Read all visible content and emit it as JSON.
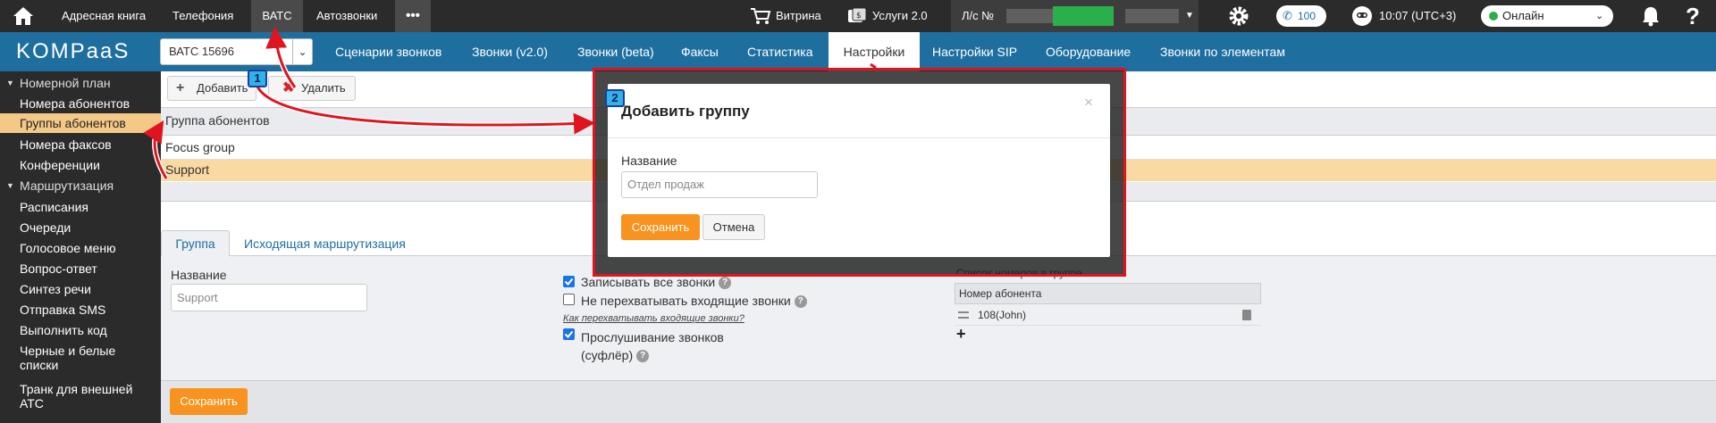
{
  "topbar": {
    "nav": [
      "Адресная книга",
      "Телефония",
      "ВАТС",
      "Автозвонки"
    ],
    "more": "•••",
    "showcase": "Витрина",
    "services": "Услуги 2.0",
    "account_label": "Л/с №",
    "calls_count": "100",
    "time": "10:07 (UTC+3)",
    "status": "Онлайн"
  },
  "subbar": {
    "logo": "KOMPaaS",
    "vats_select": "ВАТС 15696",
    "nav": [
      "Сценарии звонков",
      "Звонки (v2.0)",
      "Звонки (beta)",
      "Факсы",
      "Статистика",
      "Настройки",
      "Настройки SIP",
      "Оборудование",
      "Звонки по элементам"
    ]
  },
  "sidebar": {
    "items": [
      "Номерной план",
      "Номера абонентов",
      "Группы абонентов",
      "Номера факсов",
      "Конференции",
      "Маршрутизация",
      "Расписания",
      "Очереди",
      "Голосовое меню",
      "Вопрос-ответ",
      "Синтез речи",
      "Отправка SMS",
      "Выполнить код",
      "Черные и белые",
      "списки",
      "Транк для внешней",
      "АТС"
    ]
  },
  "toolbar": {
    "add_label": "Добавить",
    "delete_label": "Удалить"
  },
  "groups_table": {
    "header": "Группа абонентов",
    "rows": [
      "Focus group",
      "Support"
    ]
  },
  "tabs": [
    "Группа",
    "Исходящая маршрутизация"
  ],
  "group_form": {
    "name_label": "Название",
    "name_value": "Support",
    "record_all": "Записывать все звонки",
    "no_intercept": "Не перехватывать входящие звонки",
    "how_intercept": "Как перехватывать входящие звонки?",
    "listen_1": "Прослушивание звонков",
    "listen_2": "(суфлёр)",
    "numbers_title": "Список номеров в группе",
    "numbers_header": "Номер абонента",
    "numbers": [
      "108(John)"
    ],
    "save_label": "Сохранить"
  },
  "modal": {
    "title": "Добавить группу",
    "close": "×",
    "name_label": "Название",
    "name_value": "Отдел продаж",
    "save_label": "Сохранить",
    "cancel_label": "Отмена"
  },
  "badges": [
    "1",
    "2"
  ],
  "colors": {
    "topbar": "#2b2b2b",
    "brand_blue": "#1e6f9f",
    "accent_orange": "#f7931e",
    "selected_row": "#fbd9a3",
    "online_green": "#2ab04a",
    "annotation_red": "#e0141e"
  }
}
